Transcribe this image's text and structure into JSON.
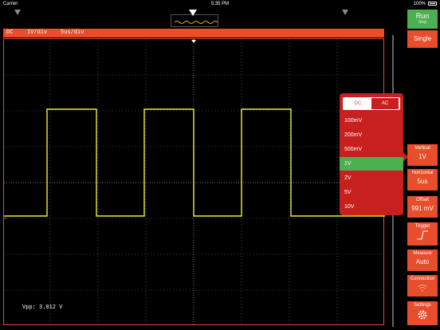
{
  "status_bar": {
    "carrier": "Carrier",
    "time": "5:35 PM",
    "battery": "100%"
  },
  "info_bar": {
    "coupling": "DC",
    "vertical": "1V/div",
    "horizontal": "5us/div"
  },
  "measurement": "Vpp: 3.012 V",
  "popup": {
    "tabs": {
      "dc": "DC",
      "ac": "AC"
    },
    "options": [
      "100mV",
      "200mV",
      "500mV",
      "1V",
      "2V",
      "5V",
      "10V"
    ],
    "selected": "1V"
  },
  "sidebar": {
    "run": {
      "label": "Run",
      "sub": "Stop"
    },
    "single": "Single",
    "vertical": {
      "title": "Vertical",
      "value": "1V"
    },
    "horizontal": {
      "title": "Horizontal",
      "value": "5us"
    },
    "offset": {
      "title": "Offset",
      "value": "991 mV"
    },
    "trigger": {
      "title": "Trigger"
    },
    "measure": {
      "title": "Measure",
      "value": "Auto"
    },
    "connection": {
      "title": "Connection"
    },
    "settings": {
      "title": "Settings"
    }
  },
  "colors": {
    "accent": "#e84d2c",
    "trace": "#e8f03a",
    "selected": "#4caf50",
    "popup": "#c8201f"
  }
}
